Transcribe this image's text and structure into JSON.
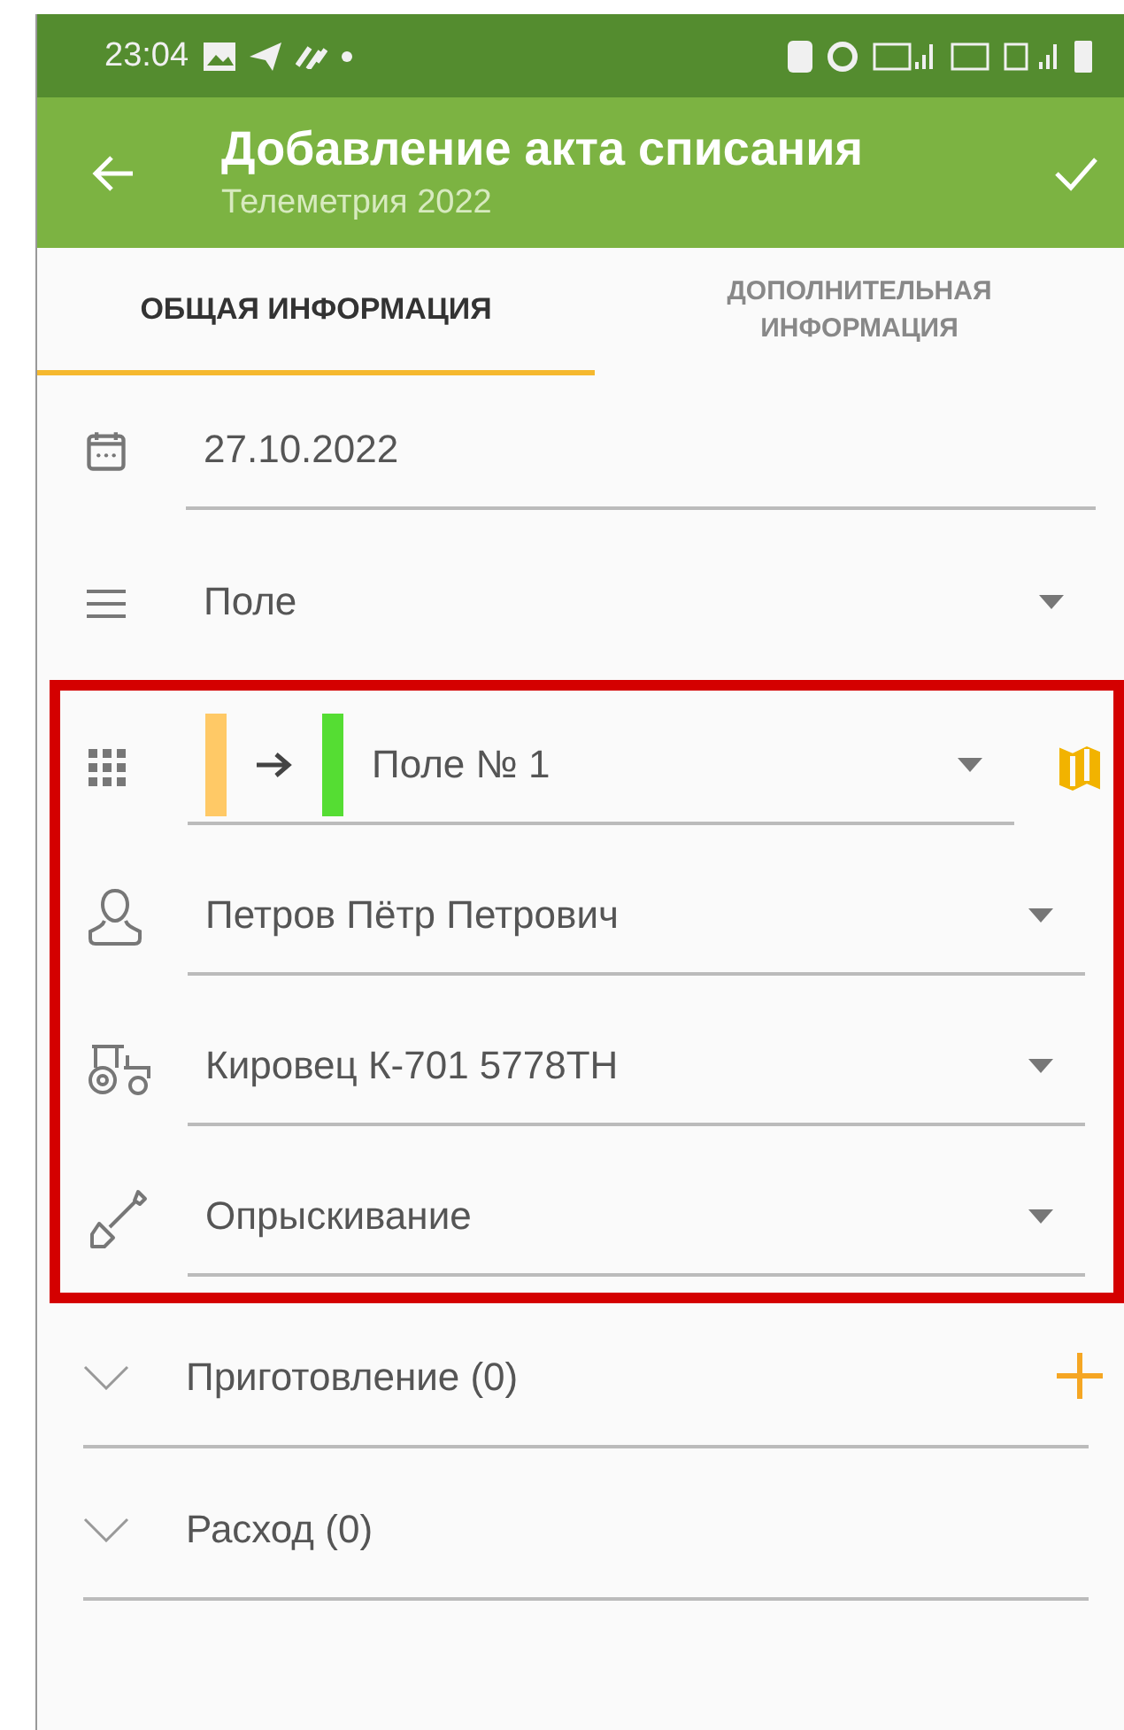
{
  "status_bar": {
    "time": "23:04"
  },
  "app_bar": {
    "title": "Добавление акта списания",
    "subtitle": "Телеметрия 2022"
  },
  "tabs": [
    {
      "label": "ОБЩАЯ ИНФОРМАЦИЯ",
      "selected": true
    },
    {
      "label": "ДОПОЛНИТЕЛЬНАЯ ИНФОРМАЦИЯ",
      "selected": false
    }
  ],
  "fields": [
    {
      "kind": "date",
      "value": "27.10.2022"
    },
    {
      "kind": "list",
      "value": "Поле"
    }
  ],
  "highlight": {
    "fields": [
      {
        "kind": "plot",
        "value": "Поле № 1",
        "swatches": [
          {
            "color": "#ffc966"
          },
          {
            "color": "#55dd33"
          }
        ]
      },
      {
        "kind": "person",
        "value": "Петров Пётр Петрович"
      },
      {
        "kind": "tractor",
        "value": "Кировец К-701 5778ТН"
      },
      {
        "kind": "sprayer",
        "value": "Опрыскивание"
      }
    ]
  },
  "sections": [
    {
      "title": "Приготовление (0)",
      "expanded": false,
      "can_add": true
    },
    {
      "title": "Расход (0)",
      "expanded": false,
      "can_add": false
    }
  ]
}
